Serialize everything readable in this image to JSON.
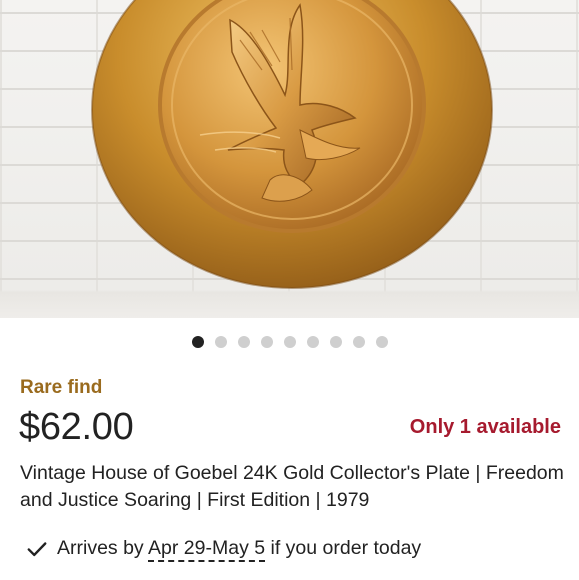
{
  "listing": {
    "image": {
      "subject": "gold-plate-eagle",
      "image_count": 9,
      "active_index": 0
    },
    "badge": "Rare find",
    "price": "$62.00",
    "availability": "Only 1 available",
    "title": "Vintage House of Goebel 24K Gold Collector's Plate | Freedom and Justice Soaring | First Edition | 1979",
    "delivery": {
      "prefix": "Arrives by",
      "date": "Apr 29-May 5",
      "suffix": "if you order today"
    }
  },
  "colors": {
    "badge": "#9a6b1e",
    "availability": "#a61a2e",
    "dot_active": "#222222",
    "dot_inactive": "#cfcfcf"
  },
  "icons": {
    "delivery": "checkmark-icon"
  }
}
